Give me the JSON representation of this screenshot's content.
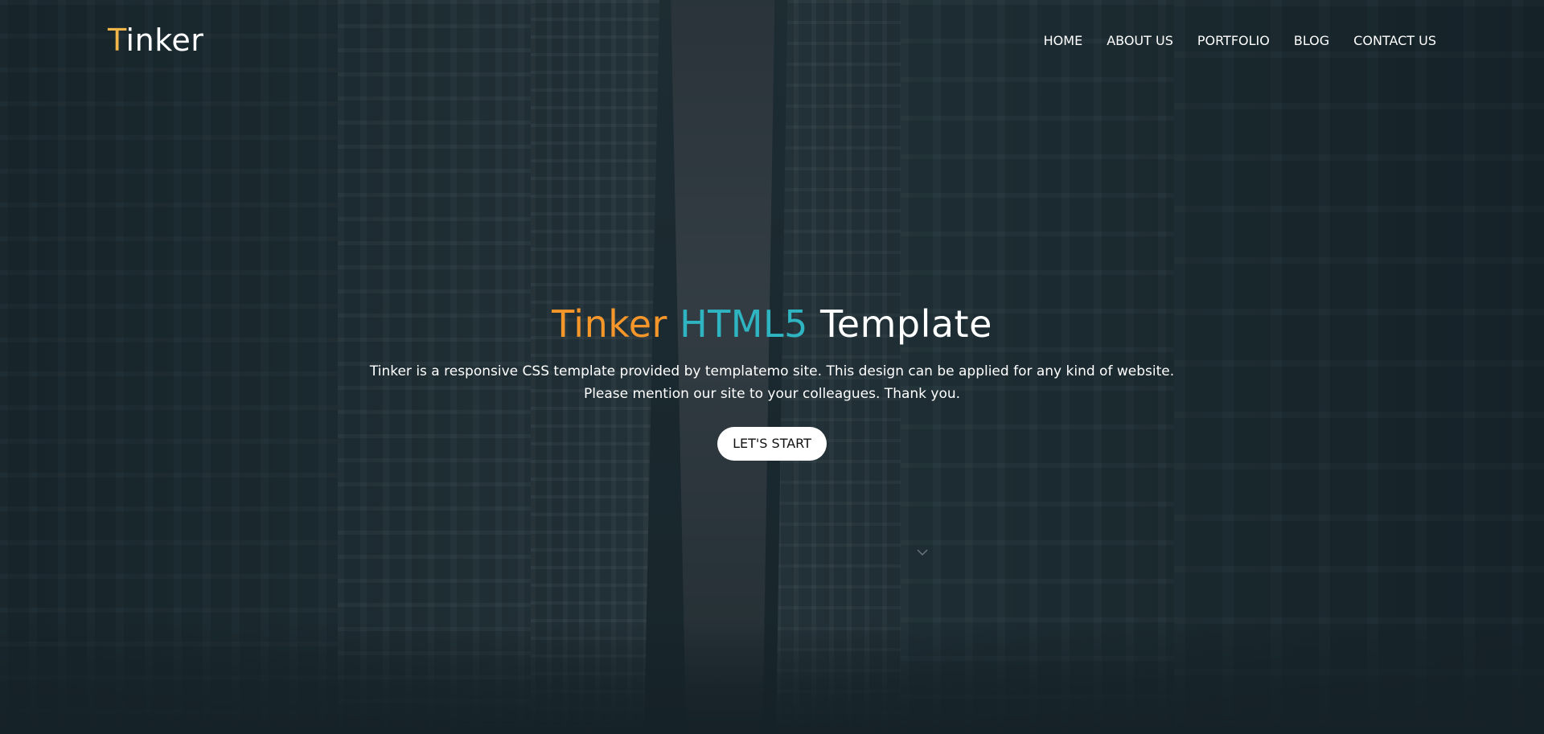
{
  "site": {
    "logo_first_letter": "T",
    "logo_rest": "inker"
  },
  "nav": {
    "items": [
      {
        "label": "HOME"
      },
      {
        "label": "ABOUT US"
      },
      {
        "label": "PORTFOLIO"
      },
      {
        "label": "BLOG"
      },
      {
        "label": "CONTACT US"
      }
    ]
  },
  "hero": {
    "title_part1": "Tinker",
    "title_part2": "HTML5",
    "title_part3": "Template",
    "description_line1": "Tinker is a responsive CSS template provided by templatemo site. This design can be applied for any kind of website.",
    "description_line2": "Please mention our site to your colleagues. Thank you.",
    "cta_label": "LET'S START"
  },
  "colors": {
    "logo_accent": "#f2b54a",
    "title_orange": "#f5962a",
    "title_teal": "#2fb4c2",
    "text": "#ffffff",
    "button_bg": "#ffffff",
    "button_text": "#111111"
  },
  "icons": {
    "scroll_hint": "chevron-down-icon"
  }
}
